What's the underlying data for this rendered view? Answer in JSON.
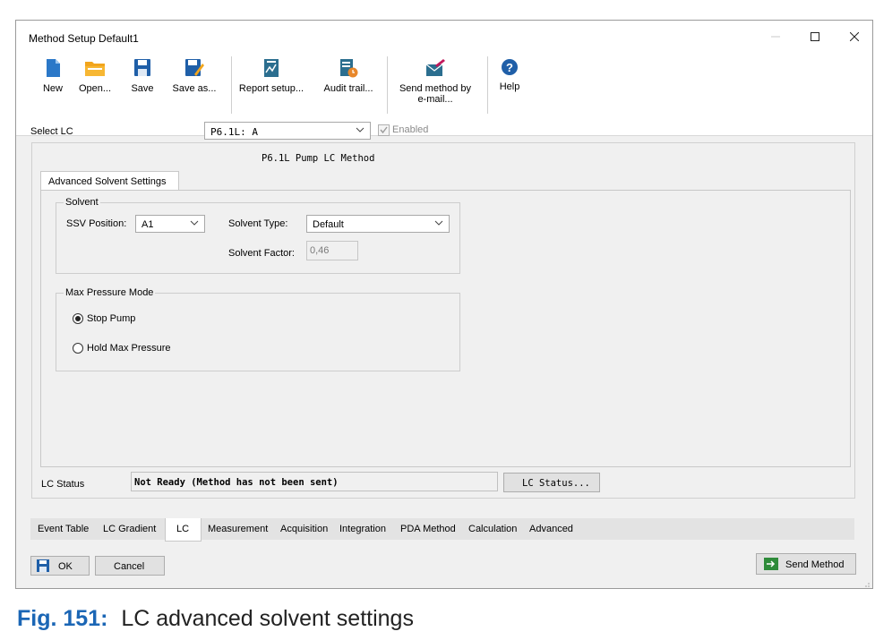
{
  "window": {
    "title": "Method Setup Default1"
  },
  "toolbar": {
    "new": "New",
    "open": "Open...",
    "save": "Save",
    "save_as": "Save as...",
    "report_setup": "Report setup...",
    "audit_trail": "Audit trail...",
    "send_method_line1": "Send method by",
    "send_method_line2": "e-mail...",
    "help": "Help"
  },
  "select_lc": {
    "label": "Select LC",
    "value": "P6.1L: A",
    "enabled_label": "Enabled",
    "enabled_checked": true
  },
  "method_title": "P6.1L Pump LC Method",
  "inner_tab": "Advanced Solvent Settings",
  "solvent": {
    "group_label": "Solvent",
    "ssv_label": "SSV Position:",
    "ssv_value": "A1",
    "type_label": "Solvent Type:",
    "type_value": "Default",
    "factor_label": "Solvent Factor:",
    "factor_value": "0,46"
  },
  "pressure": {
    "group_label": "Max Pressure Mode",
    "option_stop": "Stop Pump",
    "option_hold": "Hold Max Pressure",
    "selected": "Stop Pump"
  },
  "lc_status": {
    "label": "LC Status",
    "value": "Not Ready (Method has not been sent)",
    "button": "LC Status..."
  },
  "bottom_tabs": {
    "event_table": "Event Table",
    "lc_gradient": "LC Gradient",
    "lc": "LC",
    "measurement": "Measurement",
    "acquisition": "Acquisition",
    "integration": "Integration",
    "pda_method": "PDA Method",
    "calculation": "Calculation",
    "advanced": "Advanced",
    "active": "LC"
  },
  "footer": {
    "ok": "OK",
    "cancel": "Cancel",
    "send_method": "Send Method"
  },
  "caption": {
    "number": "Fig. 151:",
    "text": "LC advanced solvent settings"
  },
  "colors": {
    "accent_blue": "#1f5fa8",
    "caption_blue": "#1b66b5",
    "window_bg": "#f0f0f0"
  }
}
